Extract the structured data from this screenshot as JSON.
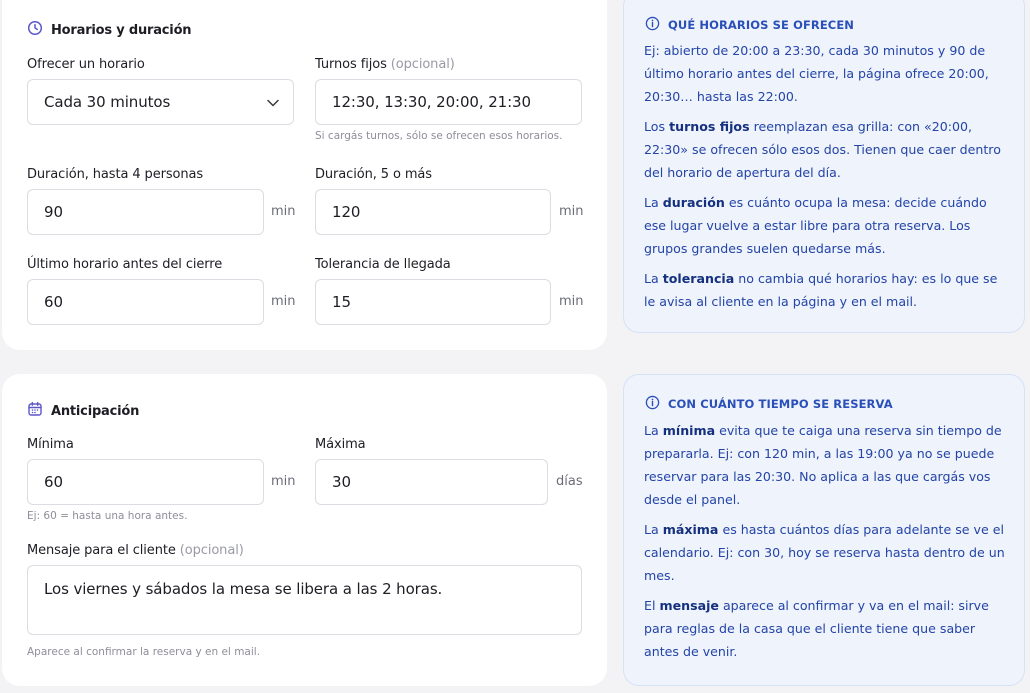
{
  "horarios": {
    "title": "Horarios y duración",
    "offer_label": "Ofrecer un horario",
    "offer_value": "Cada 30 minutos",
    "fixed_label": "Turnos fijos",
    "optional": "(opcional)",
    "fixed_value": "12:30, 13:30, 20:00, 21:30",
    "fixed_hint": "Si cargás turnos, sólo se ofrecen esos horarios.",
    "dur_small_label": "Duración, hasta 4 personas",
    "dur_small_value": "90",
    "dur_large_label": "Duración, 5 o más",
    "dur_large_value": "120",
    "last_label": "Último horario antes del cierre",
    "last_value": "60",
    "tolerance_label": "Tolerancia de llegada",
    "tolerance_value": "15",
    "unit_min": "min"
  },
  "anticipacion": {
    "title": "Anticipación",
    "min_label": "Mínima",
    "min_value": "60",
    "min_unit": "min",
    "min_hint": "Ej: 60 = hasta una hora antes.",
    "max_label": "Máxima",
    "max_value": "30",
    "max_unit": "días",
    "message_label": "Mensaje para el cliente",
    "optional": "(opcional)",
    "message_value": "Los viernes y sábados la mesa se libera a las 2 horas.",
    "message_hint": "Aparece al confirmar la reserva y en el mail."
  },
  "info_horarios": {
    "title": "QUÉ HORARIOS SE OFRECEN",
    "p1": "Ej: abierto de 20:00 a 23:30, cada 30 minutos y 90 de último horario antes del cierre, la página ofrece 20:00, 20:30… hasta las 22:00.",
    "p2_a": "Los ",
    "p2_b": "turnos fijos",
    "p2_c": " reemplazan esa grilla: con «20:00, 22:30» se ofrecen sólo esos dos. Tienen que caer dentro del horario de apertura del día.",
    "p3_a": "La ",
    "p3_b": "duración",
    "p3_c": " es cuánto ocupa la mesa: decide cuándo ese lugar vuelve a estar libre para otra reserva. Los grupos grandes suelen quedarse más.",
    "p4_a": "La ",
    "p4_b": "tolerancia",
    "p4_c": " no cambia qué horarios hay: es lo que se le avisa al cliente en la página y en el mail."
  },
  "info_anticipacion": {
    "title": "CON CUÁNTO TIEMPO SE RESERVA",
    "p1_a": "La ",
    "p1_b": "mínima",
    "p1_c": " evita que te caiga una reserva sin tiempo de prepararla. Ej: con 120 min, a las 19:00 ya no se puede reservar para las 20:30. No aplica a las que cargás vos desde el panel.",
    "p2_a": "La ",
    "p2_b": "máxima",
    "p2_c": " es hasta cuántos días para adelante se ve el calendario. Ej: con 30, hoy se reserva hasta dentro de un mes.",
    "p3_a": "El ",
    "p3_b": "mensaje",
    "p3_c": " aparece al confirmar y va en el mail: sirve para reglas de la casa que el cliente tiene que saber antes de venir."
  },
  "icons": {
    "clock": "clock-icon",
    "calendar": "calendar-icon",
    "info": "info-icon",
    "chevron": "chevron-down-icon"
  },
  "colors": {
    "accent": "#5b57c8",
    "info_bg": "#eef3fc",
    "info_text": "#2444a6"
  }
}
